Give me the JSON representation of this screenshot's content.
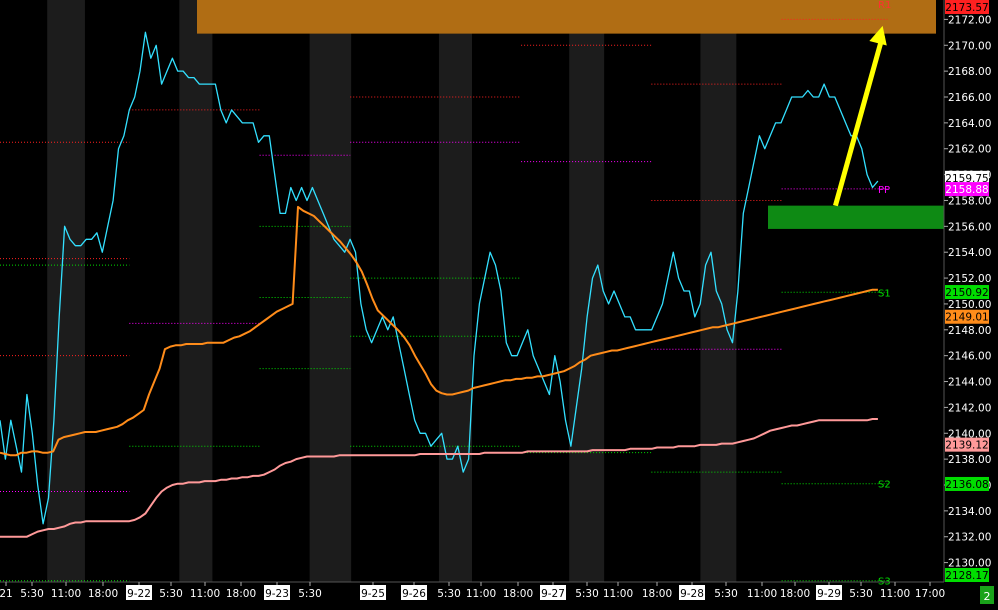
{
  "chart_data": {
    "type": "line",
    "title": "",
    "xlabel": "",
    "ylabel": "",
    "ylim": [
      2128.5,
      2173.5
    ],
    "grid": false,
    "y_ticks": [
      "2172.00",
      "2170.00",
      "2168.00",
      "2166.00",
      "2164.00",
      "2162.00",
      "2160.00",
      "2158.00",
      "2156.00",
      "2154.00",
      "2152.00",
      "2150.00",
      "2148.00",
      "2146.00",
      "2144.00",
      "2142.00",
      "2140.00",
      "2138.00",
      "2136.00",
      "2134.00",
      "2132.00",
      "2130.00"
    ],
    "x_ticks": [
      "21",
      "5:30",
      "11:00",
      "18:00",
      "9-22",
      "5:30",
      "11:00",
      "18:00",
      "9-23",
      "5:30",
      "9-25",
      "9-26",
      "5:30",
      "11:00",
      "18:00",
      "9-27",
      "5:30",
      "11:00",
      "18:00",
      "9-28",
      "5:30",
      "11:00",
      "18:00",
      "9-29",
      "5:30",
      "11:00",
      "17:00"
    ],
    "price_tags": [
      {
        "label": "2173.57",
        "value": 2173.57,
        "bg": "#ff2020",
        "fg": "#000000"
      },
      {
        "label": "2159.75",
        "value": 2159.75,
        "bg": "#ffffff",
        "fg": "#000000"
      },
      {
        "label": "2158.88",
        "value": 2158.88,
        "bg": "#ff00ff",
        "fg": "#ffffff"
      },
      {
        "label": "2150.92",
        "value": 2150.92,
        "bg": "#00dd00",
        "fg": "#000000"
      },
      {
        "label": "2149.01",
        "value": 2149.01,
        "bg": "#ff8c1a",
        "fg": "#000000"
      },
      {
        "label": "2139.12",
        "value": 2139.12,
        "bg": "#ff9999",
        "fg": "#000000"
      },
      {
        "label": "2136.08",
        "value": 2136.08,
        "bg": "#00dd00",
        "fg": "#000000"
      },
      {
        "label": "2128.17",
        "value": 2128.17,
        "bg": "#00dd00",
        "fg": "#000000"
      }
    ],
    "level_labels": [
      {
        "label": "R1",
        "value": 2173.2,
        "color": "#ff3030"
      },
      {
        "label": "PP",
        "value": 2158.9,
        "color": "#ff00ff"
      },
      {
        "label": "S1",
        "value": 2150.9,
        "color": "#00dd00"
      },
      {
        "label": "S2",
        "value": 2136.1,
        "color": "#00dd00"
      },
      {
        "label": "S3",
        "value": 2128.6,
        "color": "#00dd00"
      }
    ],
    "zones": [
      {
        "name": "resistance-zone",
        "y1": 2170.9,
        "y2": 2173.6,
        "color": "#b06d14"
      },
      {
        "name": "support-zone",
        "y1": 2155.8,
        "y2": 2157.6,
        "color": "#0e8a14"
      }
    ],
    "series": [
      {
        "color": "#33e0ff",
        "values": [
          2141,
          2138,
          2141,
          2139,
          2137,
          2143,
          2140,
          2136,
          2133,
          2135,
          2141,
          2149,
          2156,
          2155,
          2154.5,
          2154.5,
          2155,
          2155,
          2155.5,
          2154,
          2156,
          2158,
          2162,
          2163,
          2165,
          2166,
          2168,
          2171,
          2169,
          2170,
          2167,
          2168,
          2169,
          2168,
          2168,
          2167.5,
          2167.5,
          2167,
          2167,
          2167,
          2167,
          2165,
          2164,
          2165,
          2164.5,
          2164,
          2164,
          2164,
          2162.5,
          2163,
          2163,
          2160,
          2157,
          2157,
          2159,
          2158,
          2159,
          2158,
          2159,
          2158,
          2157,
          2156,
          2155,
          2154.5,
          2154,
          2155,
          2154,
          2150,
          2148,
          2147,
          2148,
          2149,
          2148,
          2149,
          2147,
          2145,
          2143,
          2141,
          2140,
          2140,
          2139,
          2139.5,
          2140,
          2138,
          2138,
          2139,
          2137,
          2138,
          2146,
          2150,
          2152,
          2154,
          2153,
          2151,
          2147,
          2146,
          2146,
          2147,
          2148,
          2146,
          2145,
          2144,
          2143,
          2146,
          2144,
          2141,
          2139,
          2142,
          2145,
          2149,
          2152,
          2153,
          2151,
          2150,
          2151,
          2150,
          2149,
          2149,
          2148,
          2148,
          2148,
          2148,
          2149,
          2150,
          2152,
          2154,
          2152,
          2151,
          2151,
          2149,
          2150,
          2153,
          2154,
          2151,
          2150,
          2148,
          2147,
          2151,
          2157,
          2159,
          2161,
          2163,
          2162,
          2163,
          2164,
          2164,
          2165,
          2166,
          2166,
          2166,
          2166.5,
          2166,
          2166,
          2167,
          2166,
          2166,
          2165,
          2164,
          2163,
          2163,
          2162,
          2160,
          2159,
          2159.5
        ]
      },
      {
        "color": "#ff8c1a",
        "values": [
          2138.5,
          2138.4,
          2138.3,
          2138.3,
          2138.5,
          2138.5,
          2138.6,
          2138.6,
          2138.5,
          2138.5,
          2138.6,
          2139.5,
          2139.7,
          2139.8,
          2139.9,
          2140,
          2140.1,
          2140.1,
          2140.1,
          2140.2,
          2140.3,
          2140.4,
          2140.5,
          2140.7,
          2141,
          2141.2,
          2141.5,
          2141.8,
          2143,
          2144,
          2145,
          2146.5,
          2146.7,
          2146.8,
          2146.8,
          2146.9,
          2146.9,
          2146.9,
          2146.9,
          2147,
          2147,
          2147,
          2147,
          2147.2,
          2147.4,
          2147.5,
          2147.7,
          2147.9,
          2148.2,
          2148.5,
          2148.8,
          2149.1,
          2149.4,
          2149.6,
          2149.8,
          2150,
          2157.5,
          2157.2,
          2157,
          2156.8,
          2156.4,
          2156,
          2155.6,
          2155.2,
          2154.8,
          2154.3,
          2153.8,
          2153.2,
          2152.5,
          2151.5,
          2150.4,
          2149.5,
          2149.1,
          2148.7,
          2148.3,
          2147.9,
          2147.4,
          2146.8,
          2146,
          2145.3,
          2144.6,
          2143.8,
          2143.3,
          2143.1,
          2143,
          2143,
          2143.1,
          2143.2,
          2143.3,
          2143.5,
          2143.6,
          2143.7,
          2143.8,
          2143.9,
          2144,
          2144.1,
          2144.1,
          2144.2,
          2144.2,
          2144.3,
          2144.3,
          2144.4,
          2144.4,
          2144.5,
          2144.6,
          2144.7,
          2144.8,
          2145,
          2145.2,
          2145.5,
          2145.7,
          2146,
          2146.1,
          2146.2,
          2146.3,
          2146.4,
          2146.4,
          2146.5,
          2146.6,
          2146.7,
          2146.8,
          2146.9,
          2147,
          2147.1,
          2147.2,
          2147.3,
          2147.4,
          2147.5,
          2147.6,
          2147.7,
          2147.8,
          2147.9,
          2148,
          2148.1,
          2148.2,
          2148.2,
          2148.3,
          2148.4,
          2148.5,
          2148.6,
          2148.7,
          2148.8,
          2148.9,
          2149,
          2149.1,
          2149.2,
          2149.3,
          2149.4,
          2149.5,
          2149.6,
          2149.7,
          2149.8,
          2149.9,
          2150,
          2150.1,
          2150.2,
          2150.3,
          2150.4,
          2150.5,
          2150.6,
          2150.7,
          2150.8,
          2150.9,
          2151,
          2151.1,
          2151.1
        ]
      },
      {
        "color": "#ff9999",
        "values": [
          2132,
          2132,
          2132,
          2132,
          2132,
          2132,
          2132.2,
          2132.4,
          2132.5,
          2132.6,
          2132.6,
          2132.7,
          2132.8,
          2133,
          2133.1,
          2133.1,
          2133.2,
          2133.2,
          2133.2,
          2133.2,
          2133.2,
          2133.2,
          2133.2,
          2133.2,
          2133.2,
          2133.3,
          2133.5,
          2133.8,
          2134.4,
          2135,
          2135.5,
          2135.8,
          2136,
          2136.1,
          2136.1,
          2136.2,
          2136.2,
          2136.2,
          2136.3,
          2136.3,
          2136.3,
          2136.4,
          2136.4,
          2136.5,
          2136.5,
          2136.6,
          2136.6,
          2136.7,
          2136.7,
          2136.8,
          2137,
          2137.2,
          2137.5,
          2137.7,
          2137.8,
          2138,
          2138.1,
          2138.2,
          2138.2,
          2138.2,
          2138.2,
          2138.2,
          2138.2,
          2138.3,
          2138.3,
          2138.3,
          2138.3,
          2138.3,
          2138.3,
          2138.3,
          2138.3,
          2138.3,
          2138.3,
          2138.3,
          2138.3,
          2138.3,
          2138.3,
          2138.3,
          2138.4,
          2138.4,
          2138.4,
          2138.4,
          2138.4,
          2138.4,
          2138.4,
          2138.4,
          2138.4,
          2138.4,
          2138.4,
          2138.4,
          2138.5,
          2138.5,
          2138.5,
          2138.5,
          2138.5,
          2138.5,
          2138.5,
          2138.5,
          2138.6,
          2138.6,
          2138.6,
          2138.6,
          2138.6,
          2138.6,
          2138.6,
          2138.6,
          2138.6,
          2138.6,
          2138.6,
          2138.6,
          2138.7,
          2138.7,
          2138.7,
          2138.7,
          2138.7,
          2138.7,
          2138.7,
          2138.8,
          2138.8,
          2138.8,
          2138.8,
          2138.8,
          2138.9,
          2138.9,
          2138.9,
          2138.9,
          2139,
          2139,
          2139,
          2139,
          2139.1,
          2139.1,
          2139.1,
          2139.1,
          2139.2,
          2139.2,
          2139.2,
          2139.3,
          2139.4,
          2139.5,
          2139.6,
          2139.8,
          2140,
          2140.2,
          2140.3,
          2140.4,
          2140.5,
          2140.6,
          2140.6,
          2140.7,
          2140.8,
          2140.9,
          2141,
          2141,
          2141,
          2141,
          2141,
          2141,
          2141,
          2141,
          2141,
          2141,
          2141.1,
          2141.1
        ]
      }
    ],
    "pivot_lines": [
      {
        "color": "#ff2020",
        "value": 2162.5,
        "x": [
          0,
          0.137
        ]
      },
      {
        "color": "#ff2020",
        "value": 2165,
        "x": [
          0.137,
          0.275
        ]
      },
      {
        "color": "#ff2020",
        "value": 2166,
        "x": [
          0.371,
          0.552
        ]
      },
      {
        "color": "#ff2020",
        "value": 2170,
        "x": [
          0.552,
          0.69
        ]
      },
      {
        "color": "#ff2020",
        "value": 2167,
        "x": [
          0.69,
          0.828
        ]
      },
      {
        "color": "#ff2020",
        "value": 2172,
        "x": [
          0.828,
          0.94
        ]
      },
      {
        "color": "#ff2020",
        "value": 2153.5,
        "x": [
          0,
          0.137
        ]
      },
      {
        "color": "#ff2020",
        "value": 2146,
        "x": [
          0,
          0.137
        ]
      },
      {
        "color": "#ff2020",
        "value": 2158,
        "x": [
          0.69,
          0.828
        ]
      },
      {
        "color": "#ff00ff",
        "value": 2161.5,
        "x": [
          0.275,
          0.371
        ]
      },
      {
        "color": "#ff00ff",
        "value": 2162.5,
        "x": [
          0.371,
          0.552
        ]
      },
      {
        "color": "#ff00ff",
        "value": 2161,
        "x": [
          0.552,
          0.69
        ]
      },
      {
        "color": "#ff00ff",
        "value": 2148.5,
        "x": [
          0.137,
          0.275
        ]
      },
      {
        "color": "#ff00ff",
        "value": 2146.5,
        "x": [
          0.69,
          0.828
        ]
      },
      {
        "color": "#ff00ff",
        "value": 2158.9,
        "x": [
          0.828,
          0.94
        ]
      },
      {
        "color": "#ff00ff",
        "value": 2135.5,
        "x": [
          0,
          0.137
        ]
      },
      {
        "color": "#00dd00",
        "value": 2156,
        "x": [
          0.275,
          0.371
        ]
      },
      {
        "color": "#00dd00",
        "value": 2152,
        "x": [
          0.371,
          0.552
        ]
      },
      {
        "color": "#00dd00",
        "value": 2147.5,
        "x": [
          0.371,
          0.552
        ]
      },
      {
        "color": "#00dd00",
        "value": 2150.5,
        "x": [
          0.275,
          0.371
        ]
      },
      {
        "color": "#00dd00",
        "value": 2145,
        "x": [
          0.275,
          0.371
        ]
      },
      {
        "color": "#00dd00",
        "value": 2139,
        "x": [
          0.137,
          0.275
        ]
      },
      {
        "color": "#00dd00",
        "value": 2139,
        "x": [
          0.371,
          0.552
        ]
      },
      {
        "color": "#00dd00",
        "value": 2138.5,
        "x": [
          0.552,
          0.69
        ]
      },
      {
        "color": "#00dd00",
        "value": 2137,
        "x": [
          0.69,
          0.828
        ]
      },
      {
        "color": "#00dd00",
        "value": 2150.9,
        "x": [
          0.828,
          0.94
        ]
      },
      {
        "color": "#00dd00",
        "value": 2136.1,
        "x": [
          0.828,
          0.94
        ]
      },
      {
        "color": "#00dd00",
        "value": 2128.6,
        "x": [
          0.828,
          0.94
        ]
      },
      {
        "color": "#00dd00",
        "value": 2153,
        "x": [
          0,
          0.137
        ]
      },
      {
        "color": "#00dd00",
        "value": 2128.6,
        "x": [
          0,
          0.137
        ]
      }
    ],
    "session_bands": [
      [
        0.05,
        0.09
      ],
      [
        0.19,
        0.225
      ],
      [
        0.328,
        0.372
      ],
      [
        0.465,
        0.5
      ],
      [
        0.603,
        0.64
      ],
      [
        0.742,
        0.78
      ]
    ],
    "trend_arrow": {
      "from": [
        0.885,
        2157.6
      ],
      "to": [
        0.935,
        2171.5
      ],
      "color": "#ffff00"
    },
    "badge": "2"
  }
}
